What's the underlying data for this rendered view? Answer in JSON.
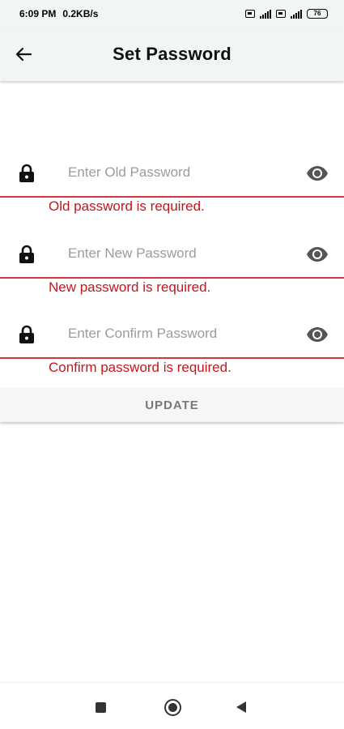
{
  "status_bar": {
    "time": "6:09 PM",
    "speed": "0.2KB/s",
    "battery": "76"
  },
  "app_bar": {
    "title": "Set Password"
  },
  "fields": [
    {
      "placeholder": "Enter Old Password",
      "value": "",
      "error": "Old password is required."
    },
    {
      "placeholder": "Enter New Password",
      "value": "",
      "error": "New password is required."
    },
    {
      "placeholder": "Enter Confirm Password",
      "value": "",
      "error": "Confirm password is required."
    }
  ],
  "update_button": {
    "label": "UPDATE"
  },
  "colors": {
    "error": "#c4161c",
    "underline": "#d8363f",
    "app_bar_bg": "#f2f5f6"
  },
  "icons": {
    "back": "arrow-left-icon",
    "field": "lock-icon",
    "toggle": "eye-icon",
    "nav": [
      "recent-apps-icon",
      "home-icon",
      "back-triangle-icon"
    ]
  }
}
